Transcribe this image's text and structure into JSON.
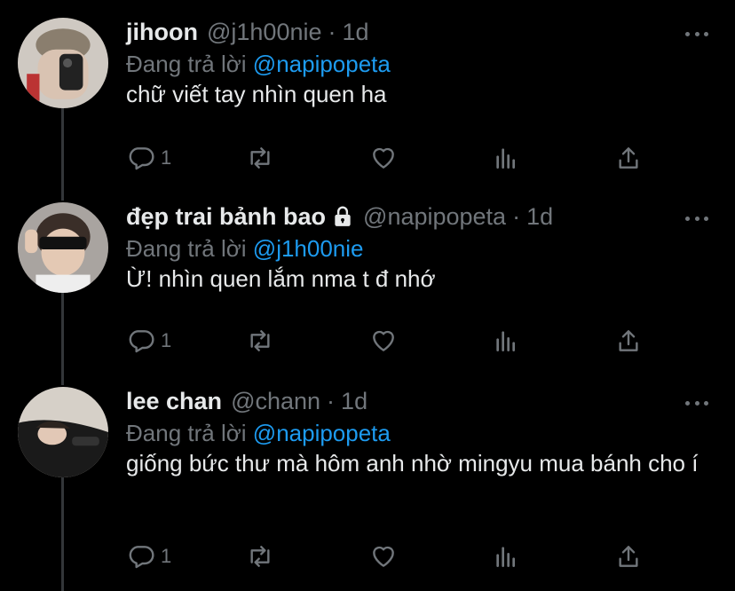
{
  "tweets": [
    {
      "name": "jihoon",
      "handle": "@j1h00nie",
      "dot": "·",
      "time": "1d",
      "reply_prefix": "Đang trả lời",
      "reply_to": "@napipopeta",
      "body": "chữ viết tay nhìn quen ha",
      "reply_count": "1",
      "protected": false
    },
    {
      "name": "đẹp trai bảnh bao",
      "handle": "@napipopeta",
      "dot": "·",
      "time": "1d",
      "reply_prefix": "Đang trả lời",
      "reply_to": "@j1h00nie",
      "body": "Ừ! nhìn quen lắm nma t đ nhớ",
      "reply_count": "1",
      "protected": true
    },
    {
      "name": "lee chan",
      "handle": "@chann",
      "dot": "·",
      "time": "1d",
      "reply_prefix": "Đang trả lời",
      "reply_to": "@napipopeta",
      "body": "giống bức thư mà hôm anh nhờ mingyu mua bánh cho í",
      "reply_count": "1",
      "protected": false
    }
  ],
  "icons": [
    "reply-icon",
    "retweet-icon",
    "like-icon",
    "views-icon",
    "share-icon",
    "more-icon",
    "lock-icon"
  ],
  "colors": {
    "background": "#000000",
    "text": "#e7e9ea",
    "muted": "#71767b",
    "link": "#1d9bf0"
  }
}
